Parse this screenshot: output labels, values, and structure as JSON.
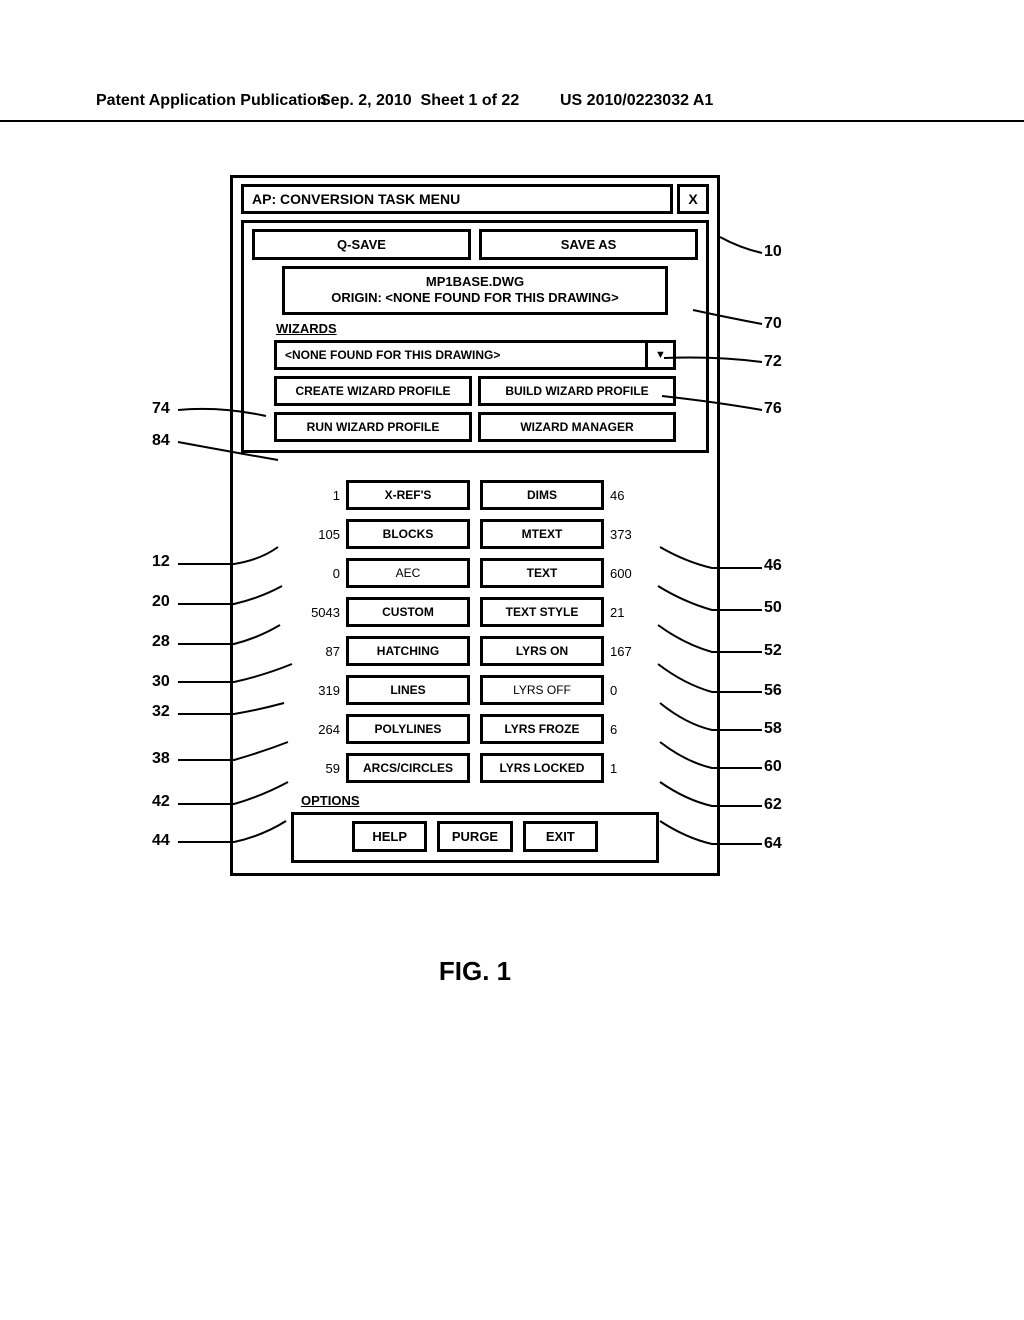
{
  "header": {
    "left": "Patent Application Publication",
    "date": "Sep. 2, 2010",
    "sheet": "Sheet 1 of 22",
    "pubno": "US 2010/0223032 A1"
  },
  "titlebar": {
    "title": "AP: CONVERSION TASK MENU",
    "close": "X"
  },
  "save": {
    "qsave": "Q-SAVE",
    "saveas": "SAVE AS"
  },
  "info": {
    "filename": "MP1BASE.DWG",
    "origin": "ORIGIN: <NONE FOUND FOR THIS DRAWING>"
  },
  "wizards": {
    "heading": "WIZARDS",
    "dropdown": "<NONE FOUND FOR THIS DRAWING>",
    "create": "CREATE WIZARD PROFILE",
    "build": "BUILD WIZARD PROFILE",
    "run": "RUN WIZARD PROFILE",
    "manager": "WIZARD MANAGER"
  },
  "stats_left": [
    {
      "label": "X-REF'S",
      "count": 1,
      "ref": "12",
      "bold": true
    },
    {
      "label": "BLOCKS",
      "count": 105,
      "ref": "20",
      "bold": true
    },
    {
      "label": "AEC",
      "count": 0,
      "ref": "28",
      "bold": false
    },
    {
      "label": "CUSTOM",
      "count": 5043,
      "ref": "30",
      "bold": true
    },
    {
      "label": "HATCHING",
      "count": 87,
      "ref": "32",
      "bold": true
    },
    {
      "label": "LINES",
      "count": 319,
      "ref": "38",
      "bold": true
    },
    {
      "label": "POLYLINES",
      "count": 264,
      "ref": "42",
      "bold": true
    },
    {
      "label": "ARCS/CIRCLES",
      "count": 59,
      "ref": "44",
      "bold": true
    }
  ],
  "stats_right": [
    {
      "label": "DIMS",
      "count": 46,
      "ref": "46",
      "bold": true
    },
    {
      "label": "MTEXT",
      "count": 373,
      "ref": "50",
      "bold": true
    },
    {
      "label": "TEXT",
      "count": 600,
      "ref": "52",
      "bold": true
    },
    {
      "label": "TEXT STYLE",
      "count": 21,
      "ref": "56",
      "bold": true
    },
    {
      "label": "LYRS ON",
      "count": 167,
      "ref": "58",
      "bold": true
    },
    {
      "label": "LYRS OFF",
      "count": 0,
      "ref": "60",
      "bold": false
    },
    {
      "label": "LYRS FROZE",
      "count": 6,
      "ref": "62",
      "bold": true
    },
    {
      "label": "LYRS LOCKED",
      "count": 1,
      "ref": "64",
      "bold": true
    }
  ],
  "options": {
    "heading": "OPTIONS",
    "help": "HELP",
    "purge": "PURGE",
    "exit": "EXIT"
  },
  "callouts": {
    "c10": "10",
    "c70": "70",
    "c72": "72",
    "c74": "74",
    "c76": "76",
    "c84": "84"
  },
  "figure_caption": "FIG. 1"
}
